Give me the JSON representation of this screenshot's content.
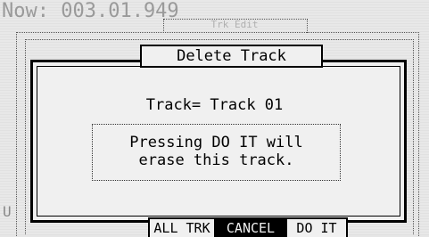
{
  "header": {
    "now_label": "Now: 003.01.949"
  },
  "background_screen": {
    "title_label": "Trk Edit",
    "side_letter": "U"
  },
  "dialog": {
    "title": "Delete Track",
    "track_line": "Track= Track 01",
    "message_lines": [
      "Pressing DO IT will",
      "erase this track."
    ]
  },
  "softkeys": [
    {
      "label": "ALL TRK",
      "active": false
    },
    {
      "label": "CANCEL",
      "active": true
    },
    {
      "label": "DO IT",
      "active": false
    }
  ]
}
